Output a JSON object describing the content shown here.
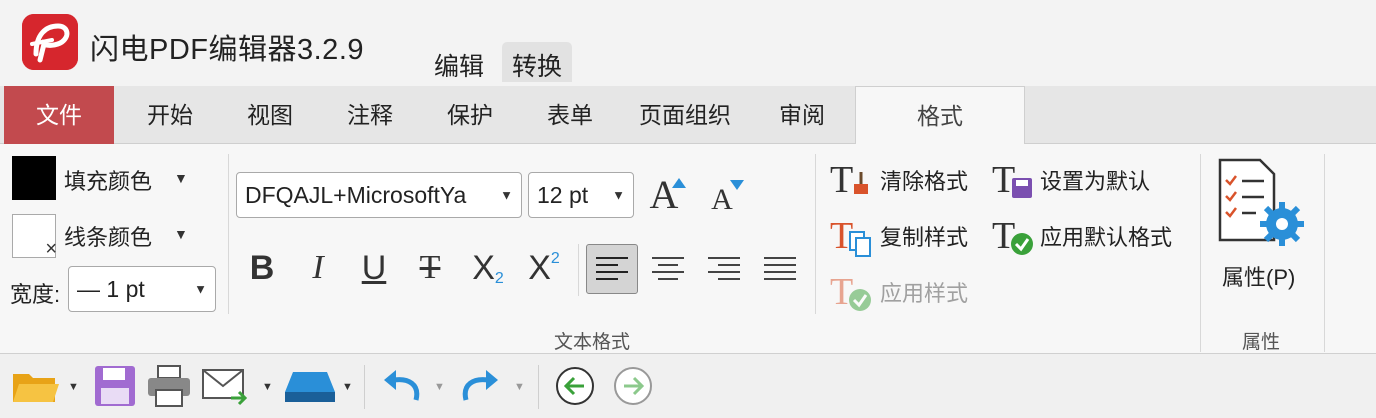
{
  "app": {
    "title": "闪电PDF编辑器3.2.9",
    "mode_tabs": [
      "编辑",
      "转换"
    ]
  },
  "menu": {
    "tabs": [
      "文件",
      "开始",
      "视图",
      "注释",
      "保护",
      "表单",
      "页面组织",
      "审阅",
      "格式"
    ],
    "active": "格式"
  },
  "ribbon": {
    "fill_color_label": "填充颜色",
    "line_color_label": "线条颜色",
    "width_label": "宽度:",
    "width_value": "— 1 pt",
    "font_name": "DFQAJL+MicrosoftYa",
    "font_size": "12 pt",
    "text_format_caption": "文本格式",
    "clear_format_label": "清除格式",
    "set_default_label": "设置为默认",
    "copy_style_label": "复制样式",
    "apply_default_format_label": "应用默认格式",
    "apply_style_label": "应用样式",
    "properties_label": "属性(P)",
    "properties_caption": "属性",
    "format_glyphs": {
      "bold": "B",
      "italic": "I",
      "underline": "U",
      "strike": "T",
      "subscript": "X",
      "subscript_mark": "2",
      "superscript": "X",
      "superscript_mark": "2",
      "grow_font": "A",
      "shrink_font": "A"
    }
  },
  "colors": {
    "file_tab": "#c24a4e",
    "fill_swatch": "#000000",
    "accent_blue": "#2a8fd8",
    "brand_red": "#d6262d"
  }
}
